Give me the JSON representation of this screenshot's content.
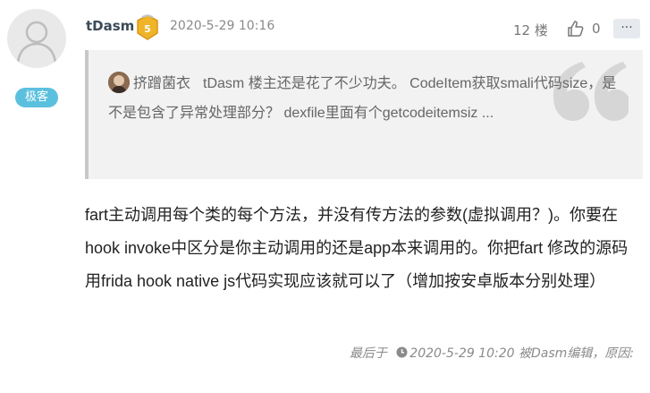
{
  "user": {
    "role_badge": "极客",
    "username": "tDasm",
    "level": "5"
  },
  "post": {
    "time": "2020-5-29 10:16",
    "floor": "12 楼",
    "like_count": "0",
    "more_label": "···"
  },
  "quote": {
    "author": "挤蹭菌衣",
    "text": "tDasm 楼主还是花了不少功夫。 CodeItem获取smali代码size，是不是包含了异常处理部分？ dexfile里面有个getcodeitemsiz ..."
  },
  "content": {
    "text": "fart主动调用每个类的每个方法，并没有传方法的参数(虚拟调用？)。你要在hook invoke中区分是你主动调用的还是app本来调用的。你把fart 修改的源码用frida  hook native js代码实现应该就可以了（增加按安卓版本分别处理）"
  },
  "edit": {
    "prefix": "最后于",
    "time": "2020-5-29 10:20",
    "by": "被Dasm编辑",
    "reason": "，原因:"
  },
  "colors": {
    "role_badge": "#5bc0de",
    "level_badge": "#f0b429",
    "quote_border": "#c8c8c8",
    "quote_bg": "#f2f2f2"
  },
  "icons": [
    "user-avatar",
    "level-badge-icon",
    "thumbs-up-icon",
    "more-icon",
    "quote-mark-icon",
    "clock-icon"
  ]
}
